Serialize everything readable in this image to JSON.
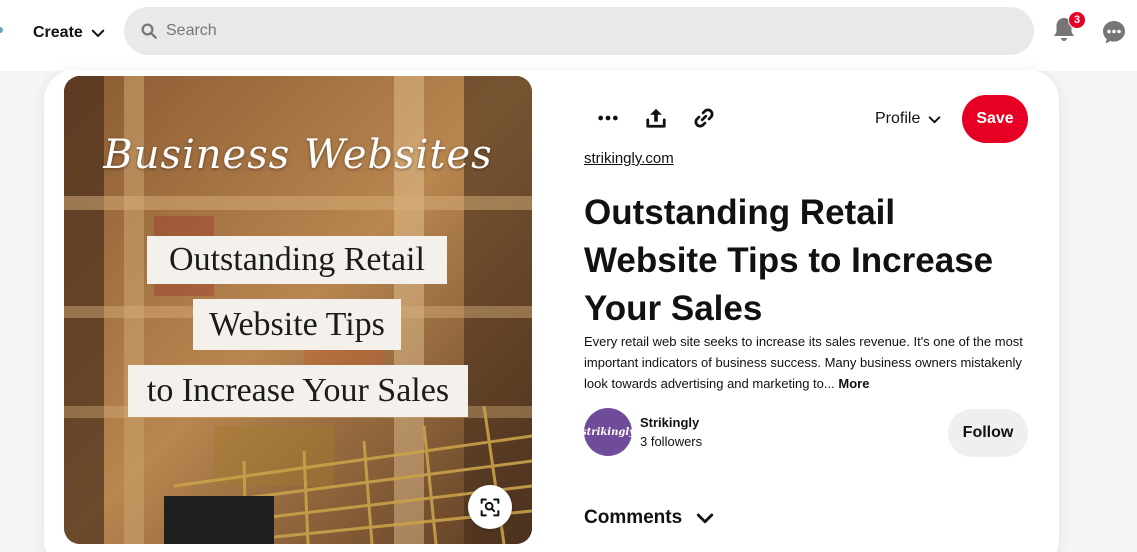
{
  "header": {
    "create_label": "Create",
    "search_placeholder": "Search",
    "notification_count": "3"
  },
  "pin": {
    "image": {
      "script_title": "Business Websites",
      "line1": "Outstanding Retail",
      "line2": "Website Tips",
      "line3": "to Increase Your Sales"
    },
    "profile_label": "Profile",
    "save_label": "Save",
    "source": "strikingly.com",
    "title": "Outstanding Retail Website Tips to Increase Your Sales",
    "description": "Every retail web site seeks to increase its sales revenue. It's one of the most important indicators of business success. Many business owners mistakenly look towards advertising and marketing to...",
    "more_label": "More",
    "creator": {
      "avatar_text": "strikingly",
      "name": "Strikingly",
      "followers": "3 followers"
    },
    "follow_label": "Follow",
    "comments_label": "Comments"
  },
  "colors": {
    "brand_red": "#e60023",
    "avatar_purple": "#6f4c9a",
    "search_bg": "#e9e9e9"
  },
  "icons": [
    "chevron-down-icon",
    "search-icon",
    "bell-icon",
    "chat-icon",
    "more-icon",
    "share-icon",
    "link-icon",
    "visual-search-icon"
  ]
}
